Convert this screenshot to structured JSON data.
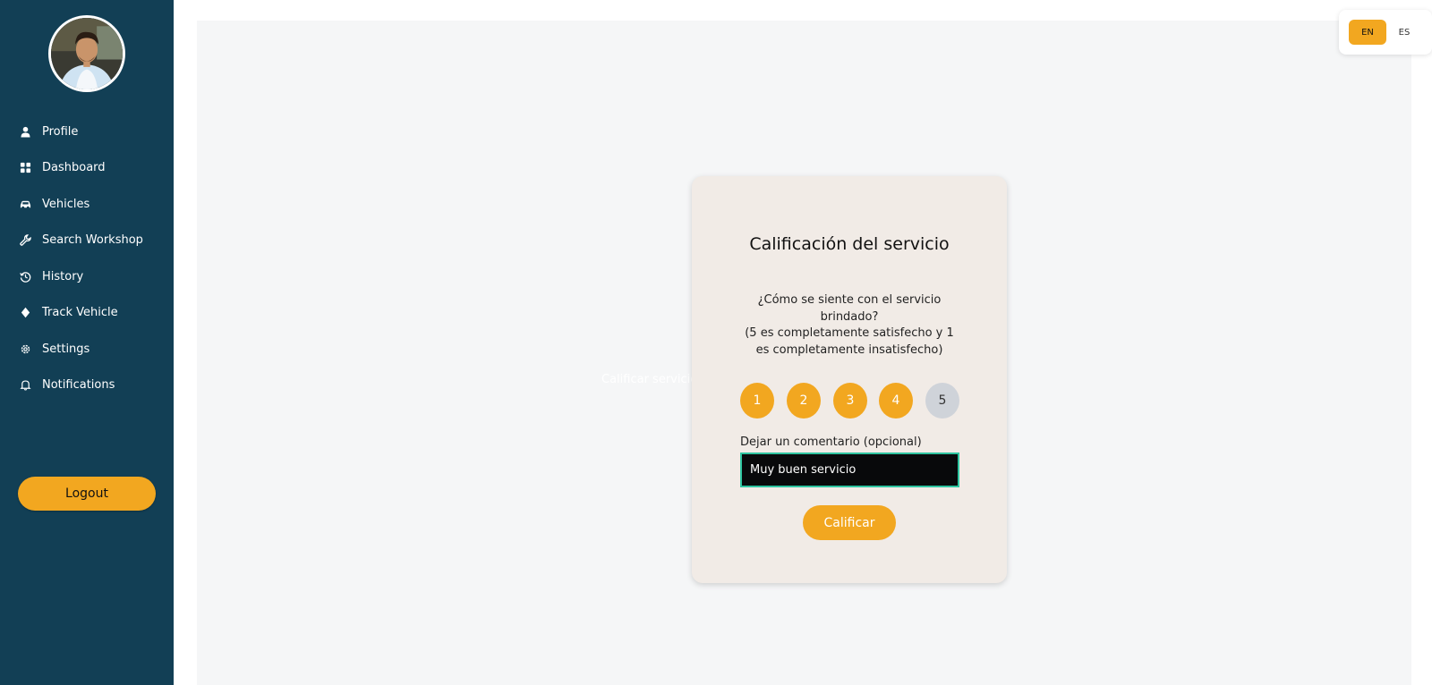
{
  "sidebar": {
    "items": [
      {
        "label": "Profile",
        "icon": "user-icon"
      },
      {
        "label": "Dashboard",
        "icon": "grid-icon"
      },
      {
        "label": "Vehicles",
        "icon": "car-icon"
      },
      {
        "label": "Search Workshop",
        "icon": "wrench-icon"
      },
      {
        "label": "History",
        "icon": "history-icon"
      },
      {
        "label": "Track Vehicle",
        "icon": "location-icon"
      },
      {
        "label": "Settings",
        "icon": "gear-icon"
      },
      {
        "label": "Notifications",
        "icon": "bell-icon"
      }
    ],
    "logout_label": "Logout"
  },
  "main": {
    "ghost_label": "Calificar servicio"
  },
  "rating_card": {
    "title": "Calificación del servicio",
    "question": "¿Cómo se siente con el servicio brindado?",
    "scale_note": "(5 es completamente satisfecho y 1 es completamente insatisfecho)",
    "options": [
      "1",
      "2",
      "3",
      "4",
      "5"
    ],
    "selected_rating": 4,
    "comment_label": "Dejar un comentario (opcional)",
    "comment_value": "Muy buen servicio",
    "submit_label": "Calificar"
  },
  "language": {
    "options": [
      "EN",
      "ES"
    ],
    "active": "EN"
  },
  "colors": {
    "sidebar_bg": "#123f55",
    "accent": "#f2a720",
    "card_bg": "#f1ebe6",
    "main_bg": "#f5f6f7",
    "input_border": "#2ec4a0"
  }
}
